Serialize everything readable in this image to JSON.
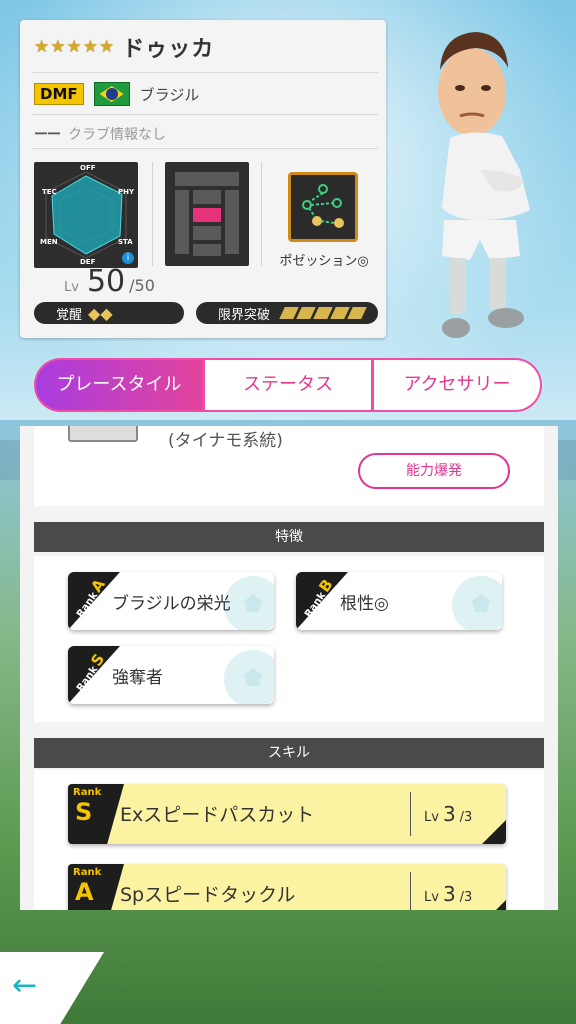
{
  "player": {
    "name": "ドゥッカ",
    "stars": [
      "★",
      "★",
      "★",
      "★",
      "★"
    ],
    "position": "DMF",
    "country": "ブラジル",
    "club_dash": "ーー",
    "club": "クラブ情報なし",
    "radar_labels": {
      "top": "OFF",
      "tl": "TEC",
      "tr": "PHY",
      "bl": "MEN",
      "br": "STA",
      "bottom": "DEF"
    },
    "info_icon": "i",
    "plan_label": "ポゼッション◎",
    "level_label": "Lv",
    "level": "50",
    "level_max": "/50",
    "awakening_label": "覚醒",
    "awakening_icon": "◆◆",
    "limit_break_label": "限界突破",
    "limit_break_level": 5
  },
  "tabs": {
    "playstyle": "プレースタイル",
    "status": "ステータス",
    "accessory": "アクセサリー"
  },
  "playstyle": {
    "type_text": "(タイナモ系統)",
    "ability_button": "能力爆発"
  },
  "traits": {
    "header": "特徴",
    "items": [
      {
        "rank_word": "Rank",
        "rank": "A",
        "label": "ブラジルの栄光"
      },
      {
        "rank_word": "Rank",
        "rank": "B",
        "label": "根性◎"
      },
      {
        "rank_word": "Rank",
        "rank": "S",
        "label": "強奪者"
      }
    ]
  },
  "skills": {
    "header": "スキル",
    "items": [
      {
        "rank_word": "Rank",
        "rank": "S",
        "label": "Exスピードパスカット",
        "lv_label": "Lv",
        "lv": "3",
        "lv_max": "/3"
      },
      {
        "rank_word": "Rank",
        "rank": "A",
        "label": "Spスピードタックル",
        "lv_label": "Lv",
        "lv": "3",
        "lv_max": "/3"
      }
    ]
  },
  "nav": {
    "back_icon": "←"
  },
  "colors": {
    "accent": "#e0388f",
    "gold": "#d5a72b",
    "dmf": "#f4c400"
  }
}
